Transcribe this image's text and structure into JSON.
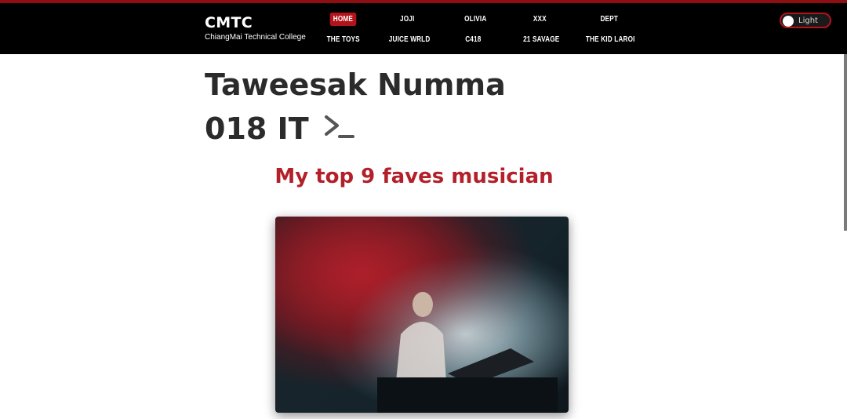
{
  "brand": {
    "title": "CMTC",
    "subtitle": "ChiangMai Technical College"
  },
  "nav": {
    "row1": [
      {
        "label": "Home",
        "active": true
      },
      {
        "label": "Joji"
      },
      {
        "label": "Olivia"
      },
      {
        "label": "XXX"
      },
      {
        "label": "Dept"
      }
    ],
    "row2": [
      {
        "label": "The Toys"
      },
      {
        "label": "Juice Wrld"
      },
      {
        "label": "C418"
      },
      {
        "label": "21 Savage"
      },
      {
        "label": "The Kid Laroi"
      }
    ]
  },
  "theme_toggle": {
    "label": "Light"
  },
  "hero": {
    "name_line1": "Taweesak Numma",
    "name_line2": "018 IT"
  },
  "section": {
    "title": "My top 9 faves musician"
  },
  "colors": {
    "accent": "#b3131a",
    "header_bg": "#000000",
    "subtitle": "#b3202a"
  }
}
